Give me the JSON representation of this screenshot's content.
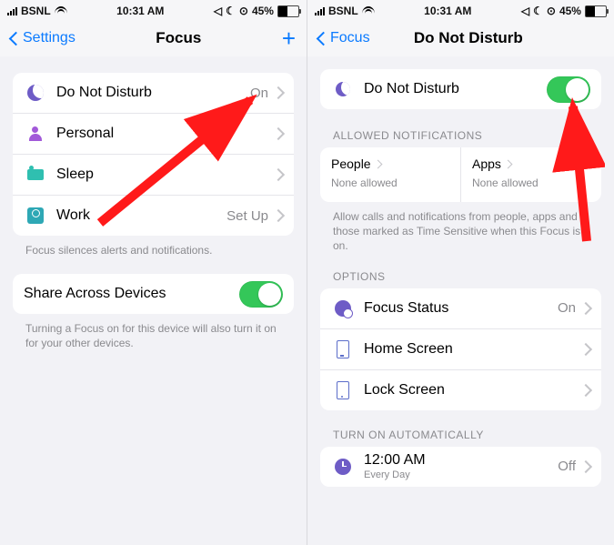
{
  "status": {
    "carrier": "BSNL",
    "time": "10:31 AM",
    "battery": "45%"
  },
  "left": {
    "back": "Settings",
    "title": "Focus",
    "modes": [
      {
        "label": "Do Not Disturb",
        "value": "On"
      },
      {
        "label": "Personal",
        "value": ""
      },
      {
        "label": "Sleep",
        "value": ""
      },
      {
        "label": "Work",
        "value": "Set Up"
      }
    ],
    "modes_footer": "Focus silences alerts and notifications.",
    "share_label": "Share Across Devices",
    "share_footer": "Turning a Focus on for this device will also turn it on for your other devices."
  },
  "right": {
    "back": "Focus",
    "title": "Do Not Disturb",
    "dnd_label": "Do Not Disturb",
    "allowed_header": "ALLOWED NOTIFICATIONS",
    "people": {
      "title": "People",
      "sub": "None allowed"
    },
    "apps": {
      "title": "Apps",
      "sub": "None allowed"
    },
    "allowed_footer": "Allow calls and notifications from people, apps and those marked as Time Sensitive when this Focus is on.",
    "options_header": "OPTIONS",
    "options": [
      {
        "label": "Focus Status",
        "value": "On"
      },
      {
        "label": "Home Screen",
        "value": ""
      },
      {
        "label": "Lock Screen",
        "value": ""
      }
    ],
    "auto_header": "TURN ON AUTOMATICALLY",
    "schedule": {
      "time": "12:00 AM",
      "repeat": "Every Day",
      "value": "Off"
    }
  }
}
